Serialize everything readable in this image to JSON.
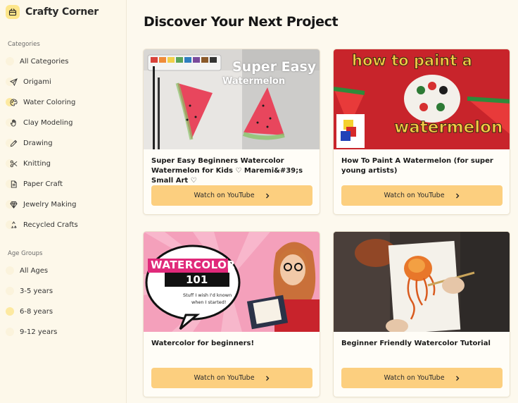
{
  "app": {
    "name": "Crafty Corner",
    "logo_icon": "scissors-box-icon"
  },
  "sidebar": {
    "categories_label": "Categories",
    "categories": [
      {
        "label": "All Categories",
        "icon": "none",
        "active": false
      },
      {
        "label": "Origami",
        "icon": "paper-plane-icon",
        "active": false
      },
      {
        "label": "Water Coloring",
        "icon": "palette-icon",
        "active": true
      },
      {
        "label": "Clay Modeling",
        "icon": "hand-icon",
        "active": false
      },
      {
        "label": "Drawing",
        "icon": "pencil-icon",
        "active": false
      },
      {
        "label": "Knitting",
        "icon": "scissors-icon",
        "active": false
      },
      {
        "label": "Paper Craft",
        "icon": "document-icon",
        "active": false
      },
      {
        "label": "Jewelry Making",
        "icon": "gem-icon",
        "active": false
      },
      {
        "label": "Recycled Crafts",
        "icon": "recycle-icon",
        "active": false
      }
    ],
    "age_groups_label": "Age Groups",
    "age_groups": [
      {
        "label": "All Ages",
        "active": false
      },
      {
        "label": "3-5 years",
        "active": false
      },
      {
        "label": "6-8 years",
        "active": true
      },
      {
        "label": "9-12 years",
        "active": false
      }
    ]
  },
  "main": {
    "title": "Discover Your Next Project",
    "cards": [
      {
        "title": "Super Easy Beginners Watercolor Watermelon for Kids ♡ Maremi&#39;s Small Art ♡",
        "button": "Watch on YouTube",
        "thumb_text": [
          "Super Easy",
          "Watermelon"
        ]
      },
      {
        "title": "How To Paint A Watermelon (for super young artists)",
        "button": "Watch on YouTube",
        "thumb_text": [
          "how to paint a",
          "watermelon"
        ]
      },
      {
        "title": "Watercolor for beginners!",
        "button": "Watch on YouTube",
        "thumb_text": [
          "WATERCOLOR",
          "101",
          "Stuff I wish I'd known",
          "when I started!"
        ]
      },
      {
        "title": "Beginner Friendly Watercolor Tutorial",
        "button": "Watch on YouTube",
        "thumb_text": []
      }
    ]
  },
  "colors": {
    "accent": "#fccf7f",
    "sidebar_bg": "#fdf8ea",
    "page_bg": "#fdf9ee",
    "active_dot": "#fde9a0"
  }
}
